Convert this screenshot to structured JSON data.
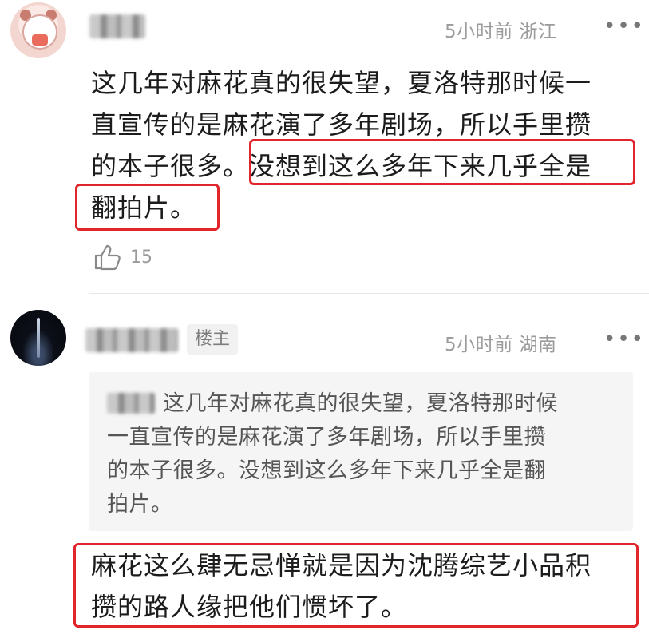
{
  "comment1": {
    "time": "5小时前",
    "location": "浙江",
    "more_label": "•••",
    "text_lines": [
      "这几年对麻花真的很失望，夏洛特那时候一",
      "直宣传的是麻花演了多年剧场，所以手里攒",
      "的本子很多。没想到这么多年下来几乎全是",
      "翻拍片。"
    ],
    "like_count": "15"
  },
  "comment2": {
    "owner_badge": "楼主",
    "time": "5小时前",
    "location": "湖南",
    "more_label": "•••",
    "quote_lines": [
      "这几年对麻花真的很失望，夏洛特那时候",
      "一直宣传的是麻花演了多年剧场，所以手里攒",
      "的本子很多。没想到这么多年下来几乎全是翻",
      "拍片。"
    ],
    "reply_lines": [
      "麻花这么肆无忌惮就是因为沈腾综艺小品积",
      "攒的路人缘把他们惯坏了。"
    ]
  },
  "colors": {
    "highlight": "#e0262b",
    "meta": "#9b9b9b",
    "quote_bg": "#f5f5f5"
  }
}
